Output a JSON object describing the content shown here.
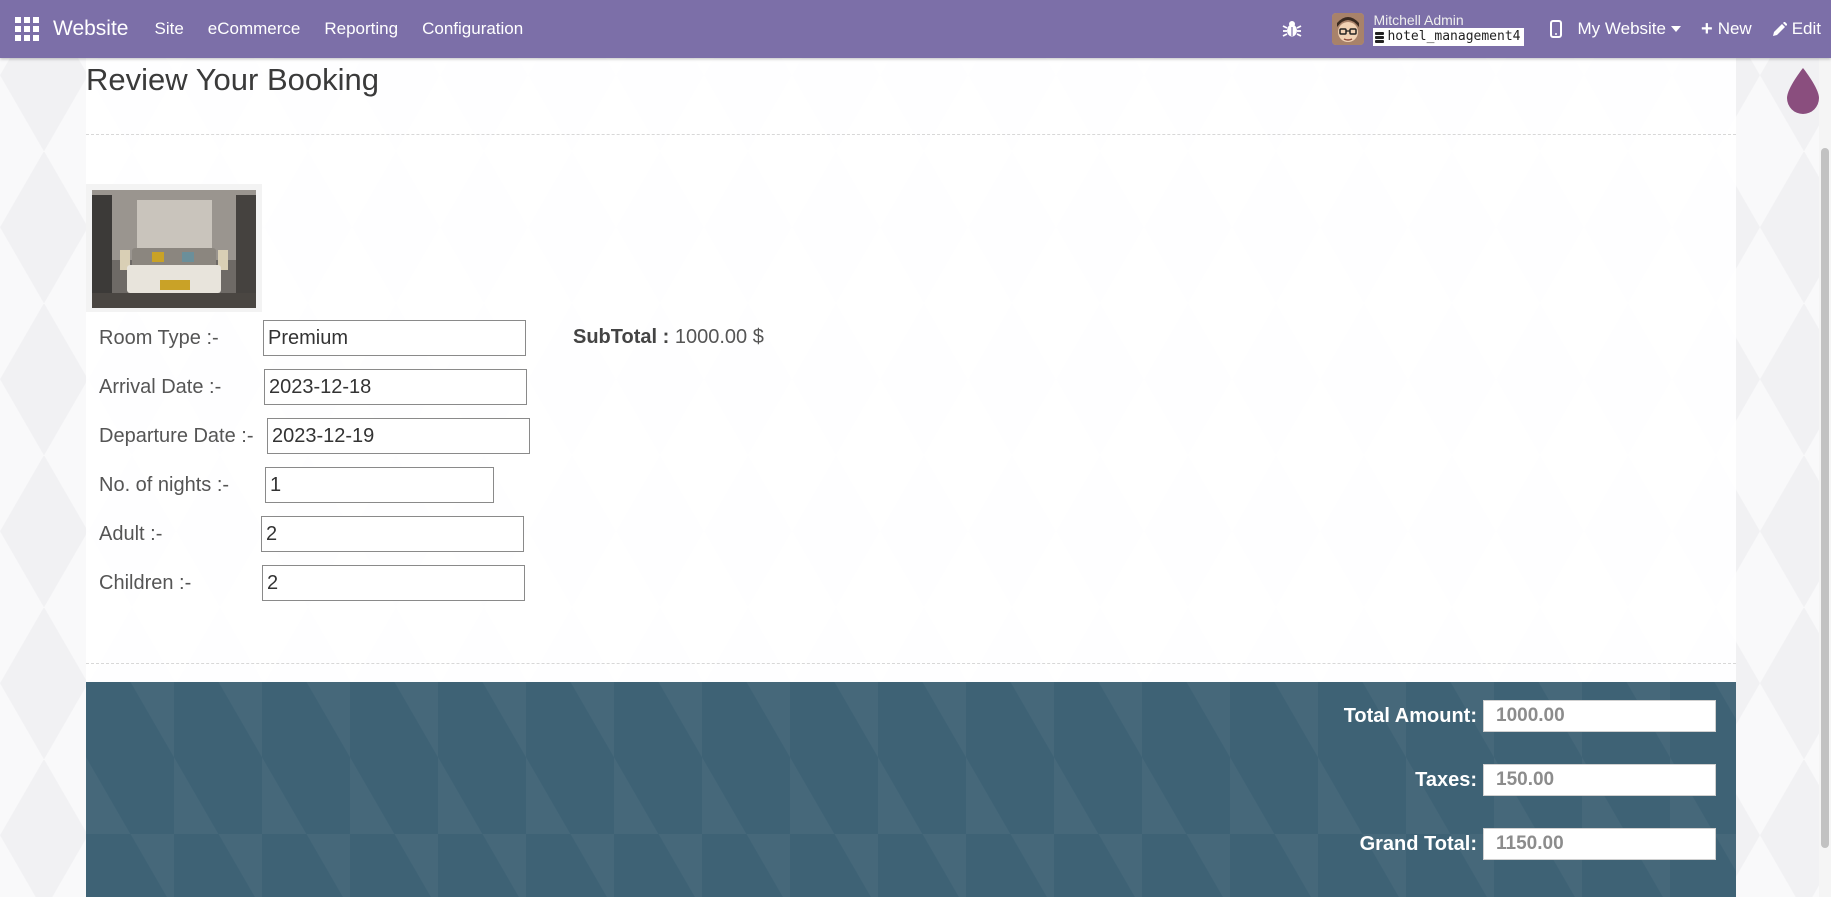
{
  "navbar": {
    "brand": "Website",
    "menu": [
      "Site",
      "eCommerce",
      "Reporting",
      "Configuration"
    ],
    "user_name": "Mitchell Admin",
    "database": "hotel_management4",
    "website_selector": "My Website",
    "new_label": "New",
    "edit_label": "Edit",
    "bar_color": "#7c6fa8"
  },
  "page": {
    "title": "Review Your Booking"
  },
  "booking": {
    "room_type_label": "Room Type :-",
    "room_type_value": "Premium",
    "arrival_label": "Arrival Date :-",
    "arrival_value": "2023-12-18",
    "departure_label": "Departure Date :-",
    "departure_value": "2023-12-19",
    "nights_label": "No. of nights :-",
    "nights_value": "1",
    "adult_label": "Adult :-",
    "adult_value": "2",
    "children_label": "Children :-",
    "children_value": "2",
    "subtotal_label": "SubTotal :",
    "subtotal_value": "1000.00 $"
  },
  "totals": {
    "total_amount_label": "Total Amount:",
    "total_amount_value": "1000.00",
    "taxes_label": "Taxes:",
    "taxes_value": "150.00",
    "grand_total_label": "Grand Total:",
    "grand_total_value": "1150.00",
    "band_color": "#3e6275"
  },
  "icons": {
    "apps": "apps-grid-icon",
    "debug": "bug-icon",
    "mobile_preview": "mobile-icon",
    "database": "database-icon",
    "new": "plus-icon",
    "edit": "pencil-icon",
    "theme": "droplet-icon"
  }
}
